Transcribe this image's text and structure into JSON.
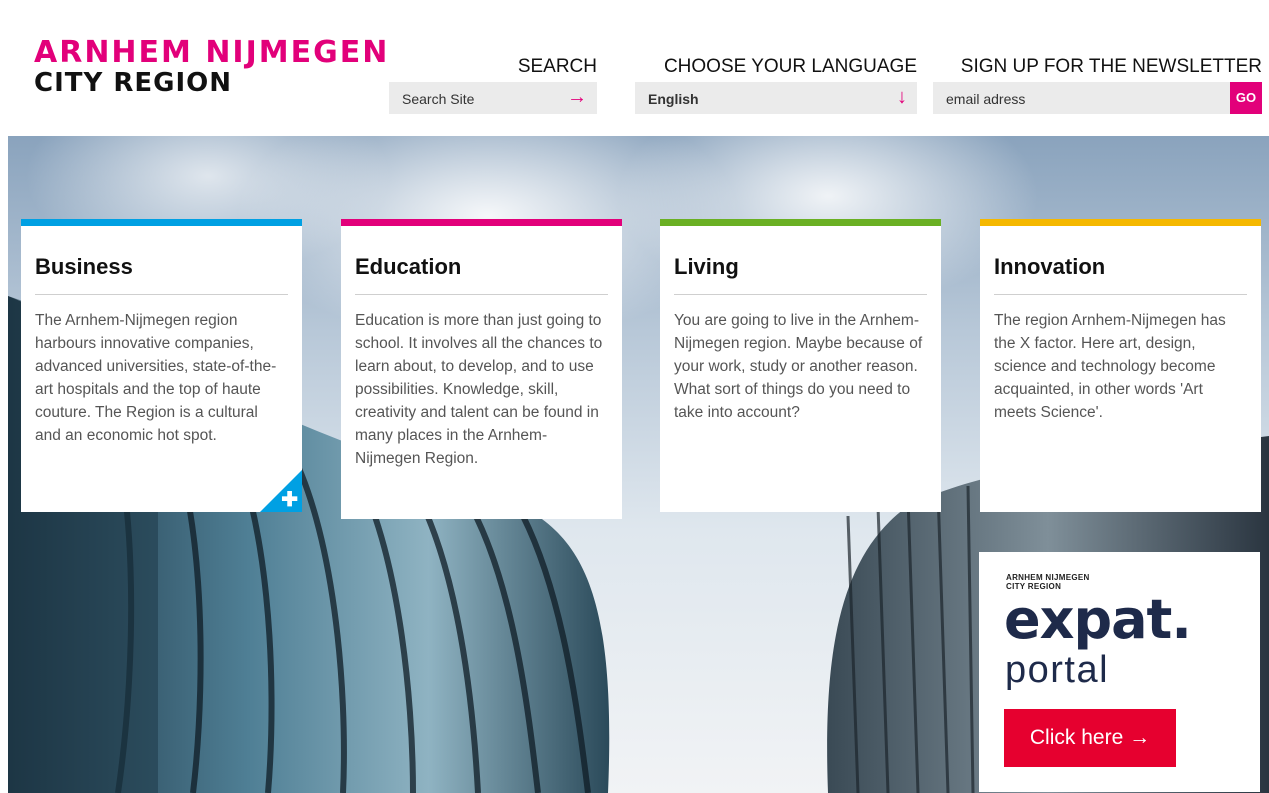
{
  "logo": {
    "line1": "ARNHEM NIJMEGEN",
    "line2": "CITY REGION"
  },
  "search": {
    "title": "SEARCH",
    "placeholder": "Search Site"
  },
  "language": {
    "title": "CHOOSE YOUR LANGUAGE",
    "selected": "English"
  },
  "newsletter": {
    "title": "SIGN UP FOR THE NEWSLETTER",
    "placeholder": "email adress",
    "go_label": "GO"
  },
  "cards": [
    {
      "title": "Business",
      "text": "The Arnhem-Nijmegen region harbours innovative companies, advanced universities, state-of-the-art hospitals and the top of haute couture. The Region is a cultural and an economic hot spot.",
      "accent": "#00a0e3"
    },
    {
      "title": "Education",
      "text": "Education is more than just going to school. It involves all the chances to learn about, to develop, and to use possibilities. Knowledge, skill, creativity and talent can be found in many places in the Arnhem-Nijmegen Region.",
      "accent": "#e2007a"
    },
    {
      "title": "Living",
      "text": "You are going to live in the Arnhem-Nijmegen region. Maybe because of your work, study or another reason. What sort of things do you need to take into account?",
      "accent": "#6ab023"
    },
    {
      "title": "Innovation",
      "text": "The region Arnhem-Nijmegen has the X factor. Here art, design, science and technology become acquainted, in other words 'Art meets Science'.",
      "accent": "#f5b800"
    }
  ],
  "expat": {
    "small_line1": "ARNHEM NIJMEGEN",
    "small_line2": "CITY REGION",
    "brand": "expat.",
    "portal": "portal",
    "cta": "Click here →"
  },
  "icons": {
    "search_arrow": "arrow-right-icon",
    "language_arrow": "arrow-down-icon",
    "card_plus": "plus-icon"
  },
  "colors": {
    "brand_pink": "#e2007a",
    "cta_red": "#e6002f",
    "blue": "#00a0e3",
    "green": "#6ab023",
    "yellow": "#f5b800"
  }
}
